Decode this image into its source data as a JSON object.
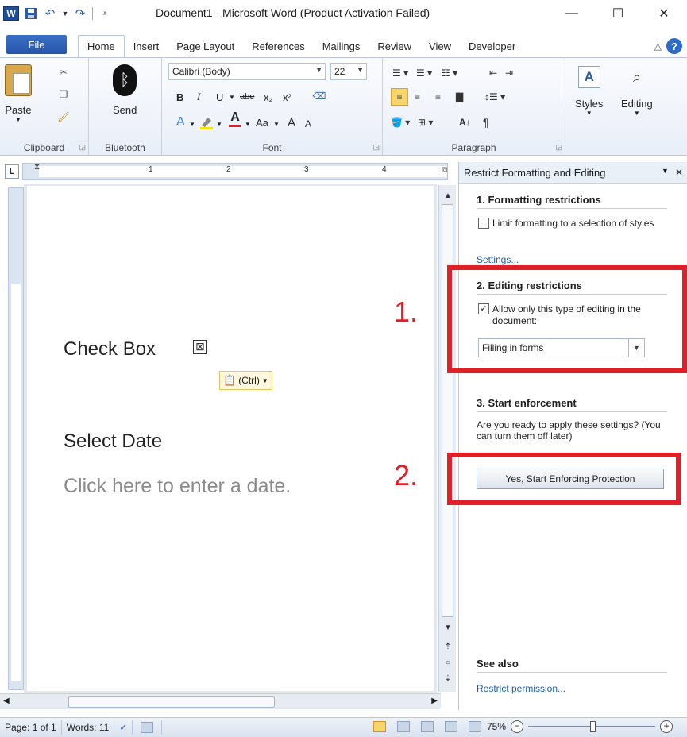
{
  "titlebar": {
    "title": "Document1 - Microsoft Word (Product Activation Failed)",
    "minimize": "—",
    "maximize": "☐",
    "close": "✕",
    "logo": "W"
  },
  "tabs": {
    "file": "File",
    "items": [
      "Home",
      "Insert",
      "Page Layout",
      "References",
      "Mailings",
      "Review",
      "View",
      "Developer"
    ],
    "help": "?"
  },
  "ribbon": {
    "clipboard": {
      "label": "Clipboard",
      "paste": "Paste"
    },
    "bluetooth": {
      "label": "Bluetooth",
      "send": "Send"
    },
    "font": {
      "label": "Font",
      "name": "Calibri (Body)",
      "size": "22",
      "bold": "B",
      "italic": "I",
      "underline": "U",
      "strike": "abe",
      "subscript": "x₂",
      "superscript": "x²",
      "change_case": "Aa",
      "grow": "A",
      "shrink": "A"
    },
    "paragraph": {
      "label": "Paragraph",
      "pilcrow": "¶"
    },
    "styles": {
      "label": "Styles"
    },
    "editing": {
      "label": "Editing"
    }
  },
  "ruler": {
    "corner": "L",
    "numbers": [
      "1",
      "2",
      "3",
      "4"
    ]
  },
  "document": {
    "heading1": "Check Box",
    "checkbox_glyph": "⊠",
    "paste_options": "(Ctrl)",
    "heading2": "Select Date",
    "placeholder": "Click here to enter a date."
  },
  "pane": {
    "title": "Restrict Formatting and Editing",
    "section1": {
      "title": "1. Formatting restrictions",
      "checkbox_label": "Limit formatting to a selection of styles",
      "checked": false,
      "link": "Settings..."
    },
    "section2": {
      "title": "2. Editing restrictions",
      "checkbox_label": "Allow only this type of editing in the document:",
      "checked": true,
      "select_value": "Filling in forms"
    },
    "section3": {
      "title": "3. Start enforcement",
      "text": "Are you ready to apply these settings? (You can turn them off later)",
      "button": "Yes, Start Enforcing Protection"
    },
    "see_also": {
      "title": "See also",
      "link": "Restrict permission..."
    }
  },
  "annotations": {
    "one": "1.",
    "two": "2.",
    "color": "#e21f26"
  },
  "statusbar": {
    "page": "Page: 1 of 1",
    "words": "Words: 11",
    "zoom": "75%"
  }
}
